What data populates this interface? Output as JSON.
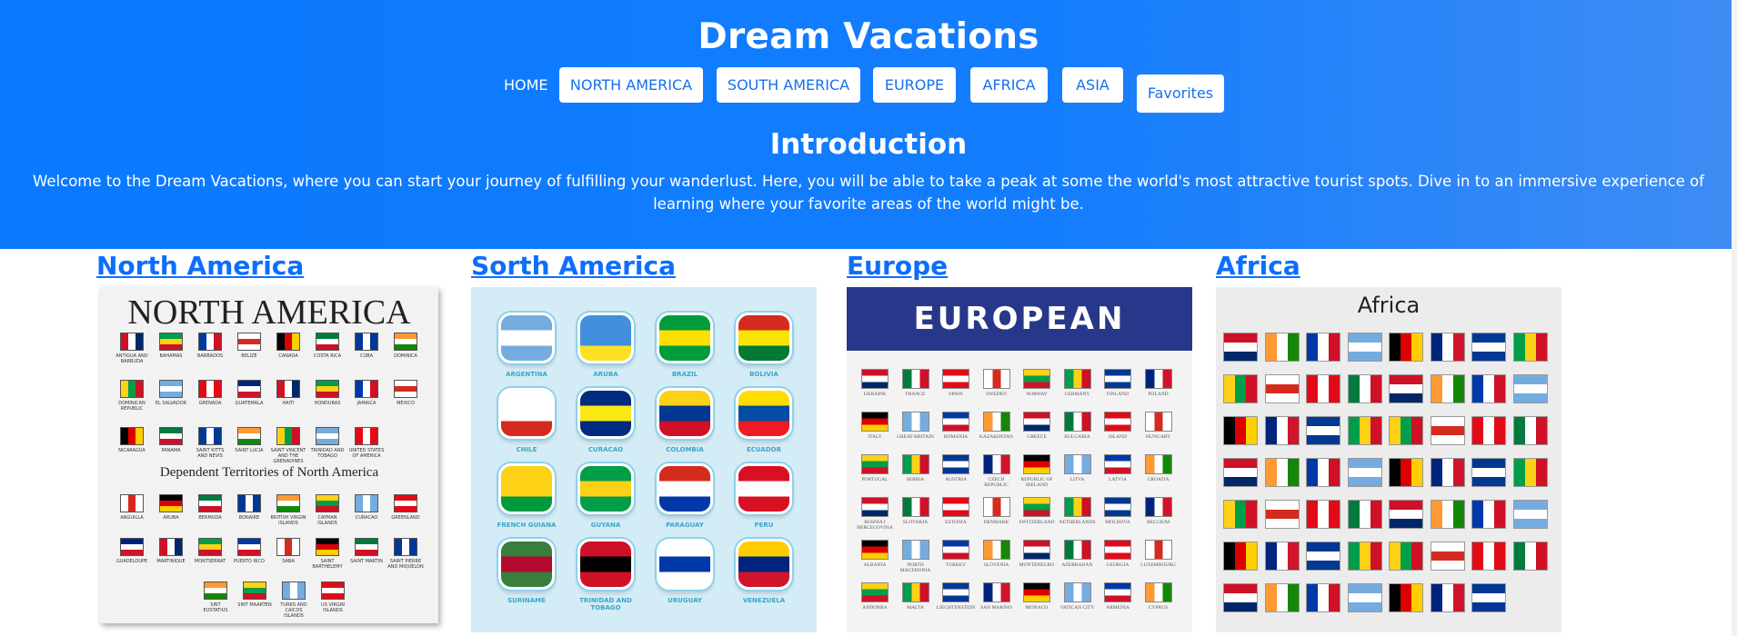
{
  "header": {
    "title": "Dream Vacations",
    "nav": {
      "home": "HOME",
      "items": [
        "NORTH AMERICA",
        "SOUTH AMERICA",
        "EUROPE",
        "AFRICA",
        "ASIA"
      ],
      "favorites": "Favorites"
    }
  },
  "intro": {
    "title": "Introduction",
    "text": "Welcome to the Dream Vacations, where you can start your journey of fulfilling your wanderlust. Here, you will be able to take a peak at some the world's most attractive tourist spots. Dive in to an immersive experience of learning where your favorite areas of the world might be."
  },
  "regions": [
    {
      "link": "North America",
      "image_heading": "NORTH AMERICA",
      "image_subheading": "Dependent Territories of North America"
    },
    {
      "link": "Sorth America"
    },
    {
      "link": "Europe",
      "image_heading": "EUROPEAN"
    },
    {
      "link": "Africa",
      "image_heading": "Africa"
    }
  ],
  "south_america_flags": [
    "ARGENTINA",
    "ARUBA",
    "BRAZIL",
    "BOLIVIA",
    "CHILE",
    "CURACAO",
    "COLOMBIA",
    "ECUADOR",
    "FRENCH GUIANA",
    "GUYANA",
    "PARAGUAY",
    "PERU",
    "SURINAME",
    "TRINIDAD AND TOBAGO",
    "URUGUAY",
    "VENEZUELA"
  ],
  "north_america_flags": [
    "ANTIGUA AND BARBUDA",
    "BAHAMAS",
    "BARBADOS",
    "BELIZE",
    "CANADA",
    "COSTA RICA",
    "CUBA",
    "DOMINICA",
    "DOMINICAN REPUBLIC",
    "EL SALVADOR",
    "GRENADA",
    "GUATEMALA",
    "HAITI",
    "HONDURAS",
    "JAMAICA",
    "MEXICO",
    "NICARAGUA",
    "PANAMA",
    "SAINT KITTS AND NEVIS",
    "SAINT LUCIA",
    "SAINT VINCENT AND THE GRENADINES",
    "TRINIDAD AND TOBAGO",
    "UNITED STATES OF AMERICA"
  ],
  "north_america_territories": [
    "ANGUILLA",
    "ARUBA",
    "BERMUDA",
    "BONAIRE",
    "BRITISH VIRGIN ISLANDS",
    "CAYMAN ISLANDS",
    "CURACAO",
    "GREENLAND",
    "GUADELOUPE",
    "MARTINIQUE",
    "MONTSERRAT",
    "PUERTO RICO",
    "SABA",
    "SAINT BARTHELEMY",
    "SAINT MARTIN",
    "SAINT PIERRE AND MIQUELON",
    "SINT EUSTATIUS",
    "SINT MAARTEN",
    "TURKS AND CAICOS ISLANDS",
    "US VIRGIN ISLANDS"
  ],
  "europe_flags": [
    "UKRAINE",
    "FRANCE",
    "SPAIN",
    "SWEDEN",
    "NORWAY",
    "GERMANY",
    "FINLAND",
    "POLAND",
    "ITALY",
    "GREAT BRITAIN",
    "ROMANIA",
    "KAZAKHSTAN",
    "GREECE",
    "BULGARIA",
    "ISLAND",
    "HUNGARY",
    "PORTUGAL",
    "SERBIA",
    "AUSTRIA",
    "CZECH REPUBLIC",
    "REPUBLIC OF IRELAND",
    "LITVA",
    "LATVIA",
    "CROATIA",
    "BOSNIA I HERCEGOVINA",
    "SLOVAKIA",
    "ESTONIA",
    "DENMARK",
    "SWITZERLAND",
    "NETHERLANDS",
    "MOLDOVA",
    "BELGIUM",
    "ALBANIA",
    "NORTH MACEDONIA",
    "TURKEY",
    "SLOVENIA",
    "MONTENEGRO",
    "AZERBAIJAN",
    "GEORGIA",
    "LUXEMBOURG",
    "ANDORRA",
    "MALTA",
    "LIECHTENSTEIN",
    "SAN MARINO",
    "MONACO",
    "VATICAN CITY",
    "ARMENIA",
    "CYPRUS"
  ],
  "colors": {
    "accent": "#0d6efd",
    "hero": "#137dfd",
    "nav_text": "#1570ee"
  }
}
